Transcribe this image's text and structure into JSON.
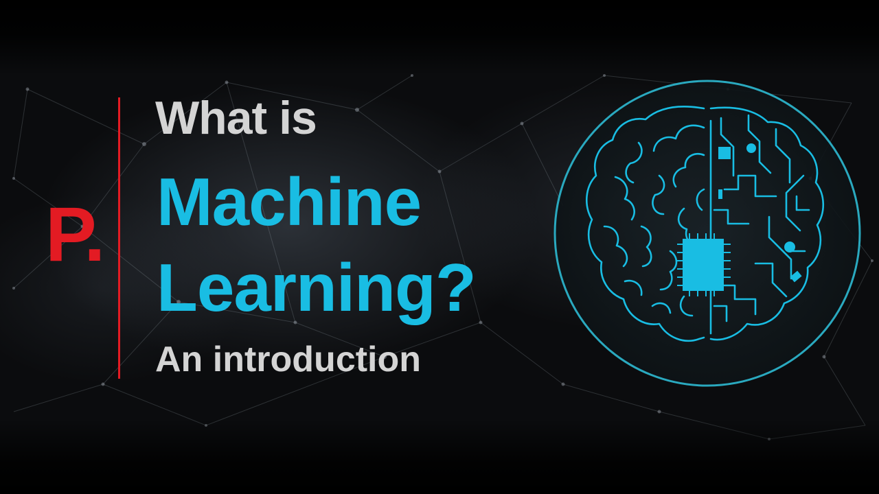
{
  "slide": {
    "logo_text": "P.",
    "heading_line1": "What is",
    "heading_line2": "Machine",
    "heading_line3": "Learning?",
    "subtitle": "An introduction"
  },
  "colors": {
    "accent_red": "#e31b23",
    "accent_cyan": "#19bde3",
    "text_light": "#d4d4d4",
    "background": "#0b0c0e"
  },
  "icons": {
    "illustration": "brain-circuit-icon"
  }
}
